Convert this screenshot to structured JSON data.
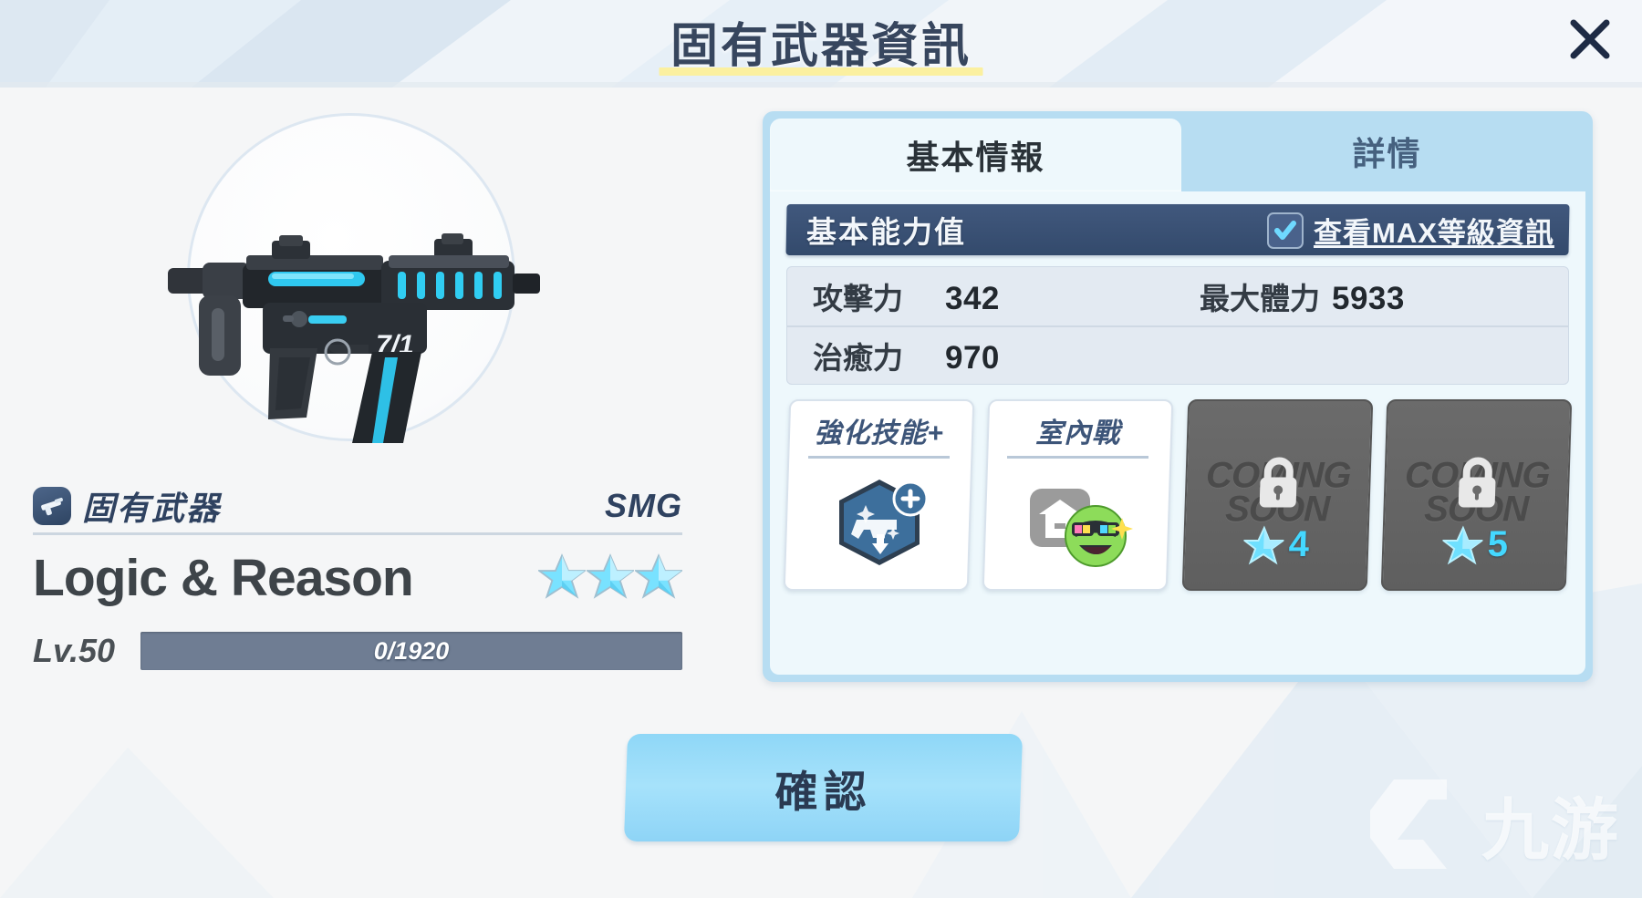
{
  "header": {
    "title": "固有武器資訊",
    "close_icon": "close-icon"
  },
  "weapon": {
    "inherent_label": "固有武器",
    "inherent_icon": "smg-badge-icon",
    "type": "SMG",
    "name": "Logic & Reason",
    "star_count": 3,
    "star_icon": "star-icon",
    "level_label": "Lv.50",
    "exp_text": "0/1920",
    "exp_current": 0,
    "exp_max": 1920,
    "exp_percent": 0,
    "art_icon": "smg-weapon-art"
  },
  "tabs": [
    {
      "label": "基本情報",
      "active": true
    },
    {
      "label": "詳情",
      "active": false
    }
  ],
  "stats_section": {
    "title": "基本能力值",
    "max_toggle_label": "查看MAX等級資訊",
    "max_toggle_checked": true,
    "check_icon": "check-icon",
    "rows": [
      [
        {
          "name": "攻擊力",
          "value": "342"
        },
        {
          "name": "最大體力",
          "value": "5933"
        }
      ],
      [
        {
          "name": "治癒力",
          "value": "970"
        },
        {
          "name": "",
          "value": ""
        }
      ]
    ]
  },
  "skill_cards": [
    {
      "title": "強化技能+",
      "locked": false,
      "icon": "hex-pistol-plus-icon"
    },
    {
      "title": "室內戰",
      "locked": false,
      "icon": "indoor-battle-icon"
    },
    {
      "title": "",
      "locked": true,
      "coming_soon_line1": "COMING",
      "coming_soon_line2": "SOON",
      "lock_icon": "lock-icon",
      "star_icon": "star-icon",
      "star_requirement": "4"
    },
    {
      "title": "",
      "locked": true,
      "coming_soon_line1": "COMING",
      "coming_soon_line2": "SOON",
      "lock_icon": "lock-icon",
      "star_icon": "star-icon",
      "star_requirement": "5"
    }
  ],
  "confirm": {
    "label": "確認"
  },
  "watermark": {
    "text": "九游",
    "logo_icon": "nine-game-logo-icon"
  },
  "colors": {
    "accent_cyan": "#44d8ff",
    "panel_blue": "#b7ddf2",
    "panel_body": "#eef8fc",
    "section_navy": "#334a6c",
    "title_navy": "#37465e",
    "title_underline": "#fbf0a0",
    "confirm_blue": "#9bdcf9",
    "locked_gray": "#636363"
  }
}
